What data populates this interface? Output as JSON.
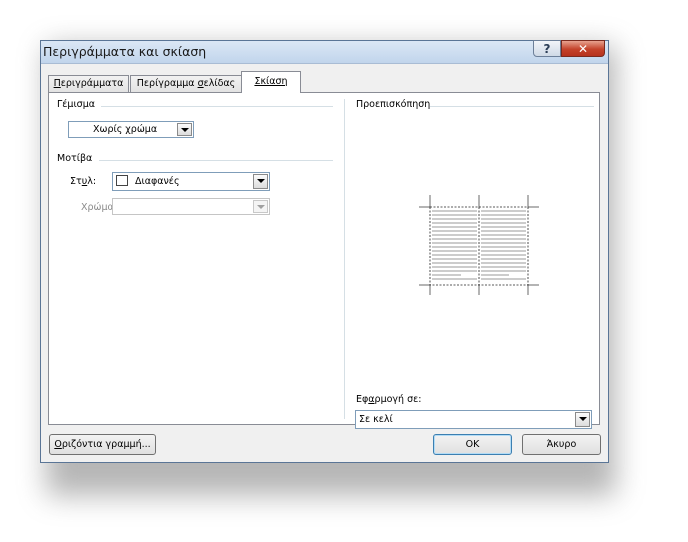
{
  "window": {
    "title": "Περιγράμματα και σκίαση",
    "help_glyph": "?",
    "close_glyph": "✕"
  },
  "tabs": [
    {
      "label_pre": "",
      "label_u": "Π",
      "label_post": "εριγράμματα",
      "active": false
    },
    {
      "label_pre": "Περίγραμμα ",
      "label_u": "σ",
      "label_post": "ελίδας",
      "active": false
    },
    {
      "label_pre": "Σκίαση",
      "label_u": "",
      "label_post": "",
      "active": true
    }
  ],
  "fill": {
    "group_label": "Γέμισμα",
    "selected": "Χωρίς χρώμα"
  },
  "patterns": {
    "group_label": "Μοτίβα",
    "style_label_pre": "Στ",
    "style_label_u": "υ",
    "style_label_post": "λ:",
    "style_value": "Διαφανές",
    "color_label": "Χρώμα:",
    "color_value": ""
  },
  "preview": {
    "group_label": "Προεπισκόπηση"
  },
  "apply_to": {
    "label_pre": "Εφ",
    "label_u": "α",
    "label_post": "ρμογή σε:",
    "selected": "Σε κελί"
  },
  "buttons": {
    "horizontal_line_u": "Ο",
    "horizontal_line_rest": "ριζόντια γραμμή...",
    "ok": "OK",
    "cancel": "Άκυρο"
  },
  "colors": {
    "titlebar": "#c1d5ec",
    "close_button": "#c4422a",
    "panel": "#ffffff",
    "dialog_bg": "#f0f0f0"
  }
}
